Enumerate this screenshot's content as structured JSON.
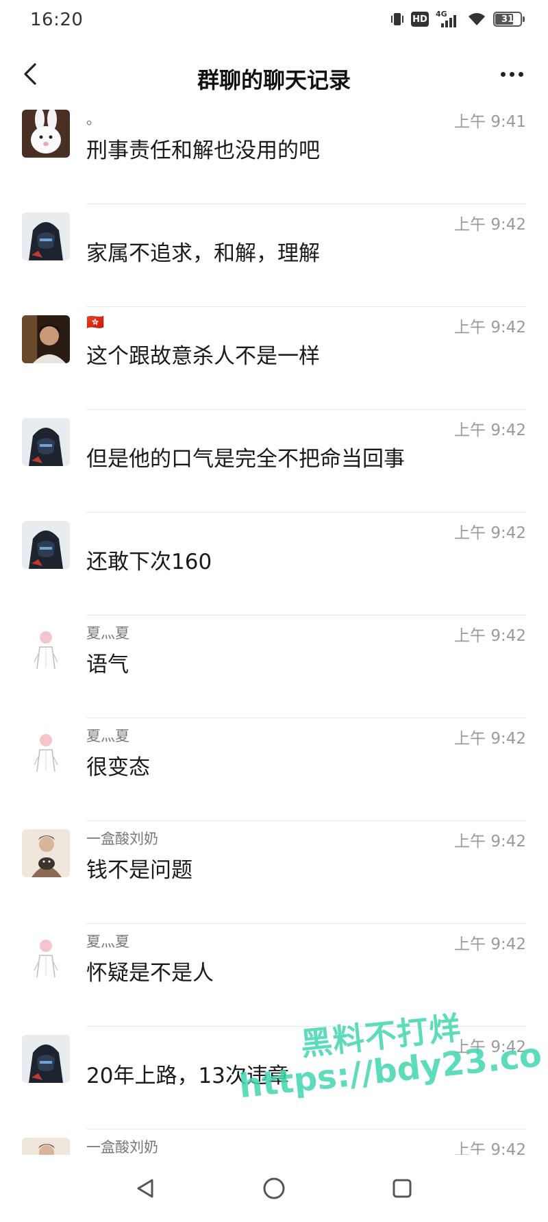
{
  "status_bar": {
    "time": "16:20",
    "hd_label": "HD",
    "network_label": "4G",
    "battery_level": "31"
  },
  "header": {
    "title": "群聊的聊天记录",
    "back_icon": "chevron-left-icon",
    "more_icon": "more-horizontal-icon"
  },
  "messages": [
    {
      "sender": "。",
      "time": "上午 9:41",
      "text": "刑事责任和解也没用的吧",
      "avatar": "rabbit-avatar"
    },
    {
      "sender": "",
      "time": "上午 9:42",
      "text": "家属不追求，和解，理解",
      "avatar": "hooded-figure-avatar"
    },
    {
      "sender": "🇭🇰",
      "time": "上午 9:42",
      "text": "这个跟故意杀人不是一样",
      "avatar": "man-photo-avatar"
    },
    {
      "sender": "",
      "time": "上午 9:42",
      "text": "但是他的口气是完全不把命当回事",
      "avatar": "hooded-figure-avatar"
    },
    {
      "sender": "",
      "time": "上午 9:42",
      "text": "还敢下次160",
      "avatar": "hooded-figure-avatar"
    },
    {
      "sender": "夏灬夏",
      "time": "上午 9:42",
      "text": "语气",
      "avatar": "sketch-figure-avatar"
    },
    {
      "sender": "夏灬夏",
      "time": "上午 9:42",
      "text": "很变态",
      "avatar": "sketch-figure-avatar"
    },
    {
      "sender": "一盒酸刘奶",
      "time": "上午 9:42",
      "text": "钱不是问题",
      "avatar": "cat-hug-avatar"
    },
    {
      "sender": "夏灬夏",
      "time": "上午 9:42",
      "text": "怀疑是不是人",
      "avatar": "sketch-figure-avatar"
    },
    {
      "sender": "",
      "time": "上午 9:42",
      "text": "20年上路，13次违章",
      "avatar": "hooded-figure-avatar"
    },
    {
      "sender": "一盒酸刘奶",
      "time": "上午 9:42",
      "text": "",
      "avatar": "cat-hug-avatar"
    }
  ],
  "watermark": {
    "line1": "黑料不打烊",
    "line2": "https://bdy23.co"
  },
  "colors": {
    "accent_watermark": "#41d7b0",
    "timestamp": "#9a9a9a",
    "divider": "#e8e8e8"
  }
}
